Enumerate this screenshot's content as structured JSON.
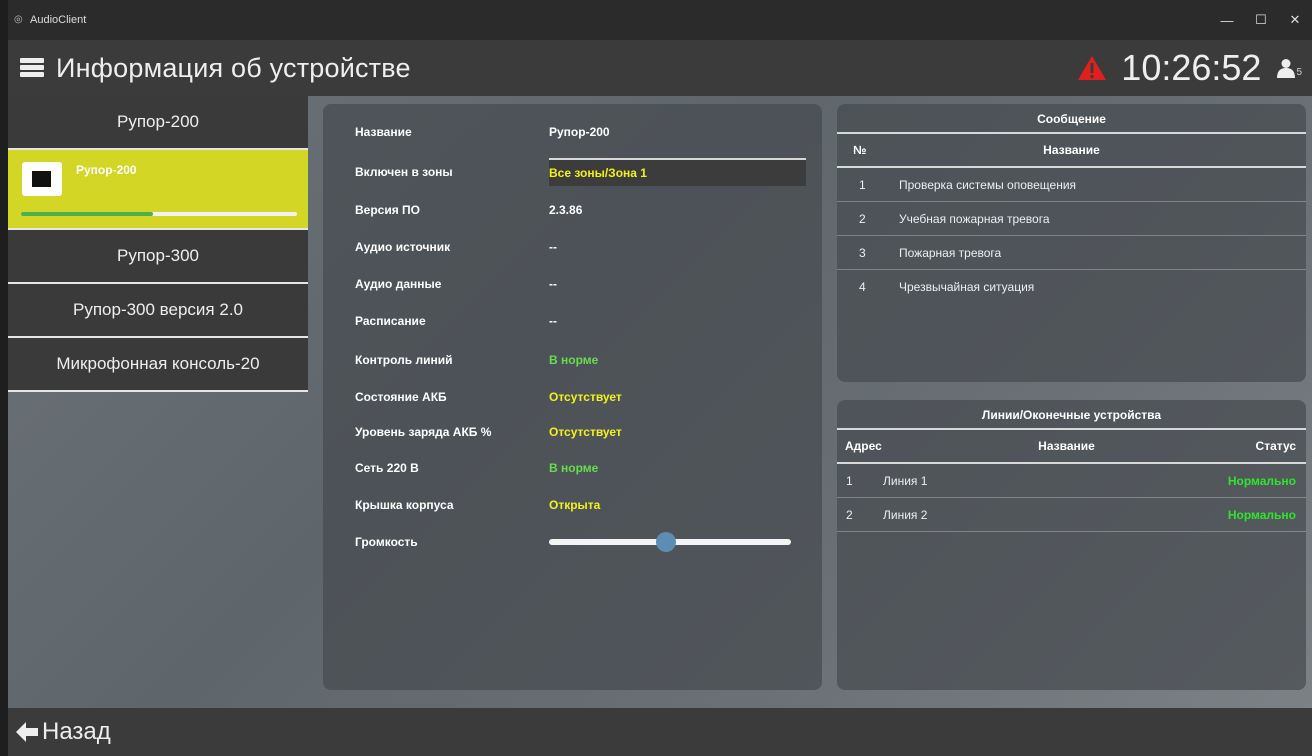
{
  "window": {
    "title": "AudioClient",
    "minimize": "—",
    "maximize": "☐",
    "close": "✕"
  },
  "header": {
    "title": "Информация об устройстве",
    "time": "10:26:52",
    "user_count": "5"
  },
  "sidebar": {
    "items": [
      {
        "label": "Рупор-200"
      },
      {
        "label": "Рупор-300"
      },
      {
        "label": "Рупор-300 версия 2.0"
      },
      {
        "label": "Микрофонная консоль-20"
      }
    ],
    "selected_device": {
      "name": "Рупор-200",
      "progress": 0.48
    }
  },
  "info": {
    "rows": [
      {
        "label": "Название",
        "value": "Рупор-200",
        "color": "#ffffff"
      },
      {
        "label": "Включен в зоны",
        "value": "Все зоны/Зона 1",
        "color": "#f2f21a"
      },
      {
        "label": "Версия ПО",
        "value": "2.3.86",
        "color": "#ffffff"
      },
      {
        "label": "Аудио источник",
        "value": "--",
        "color": "#ffffff"
      },
      {
        "label": "Аудио данные",
        "value": "--",
        "color": "#ffffff"
      },
      {
        "label": "Расписание",
        "value": "--",
        "color": "#ffffff"
      },
      {
        "label": "Контроль линий",
        "value": "В норме",
        "color": "#66dd4e"
      },
      {
        "label": "Состояние АКБ",
        "value": "Отсутствует",
        "color": "#f2f21a"
      },
      {
        "label": "Уровень заряда АКБ %",
        "value": "Отсутствует",
        "color": "#f2f21a"
      },
      {
        "label": "Сеть 220 В",
        "value": "В норме",
        "color": "#66dd4e"
      },
      {
        "label": "Крышка корпуса",
        "value": "Открыта",
        "color": "#f2f21a"
      },
      {
        "label": "Громкость",
        "value": "",
        "color": "#ffffff"
      }
    ],
    "volume": 0.48
  },
  "messages": {
    "title": "Сообщение",
    "col_num": "№",
    "col_name": "Название",
    "rows": [
      {
        "num": "1",
        "name": "Проверка системы оповещения"
      },
      {
        "num": "2",
        "name": "Учебная пожарная тревога"
      },
      {
        "num": "3",
        "name": "Пожарная тревога"
      },
      {
        "num": "4",
        "name": "Чрезвычайная ситуация"
      }
    ]
  },
  "lines": {
    "title": "Линии/Оконечные устройства",
    "col_addr": "Адрес",
    "col_name": "Название",
    "col_status": "Статус",
    "rows": [
      {
        "addr": "1",
        "name": "Линия 1",
        "status": "Нормально"
      },
      {
        "addr": "2",
        "name": "Линия 2",
        "status": "Нормально"
      }
    ]
  },
  "footer": {
    "back_label": "Назад"
  },
  "colors": {
    "accent_yellow": "#d4d625",
    "ok_green": "#2ee52e",
    "alarm_red": "#e0201e"
  }
}
